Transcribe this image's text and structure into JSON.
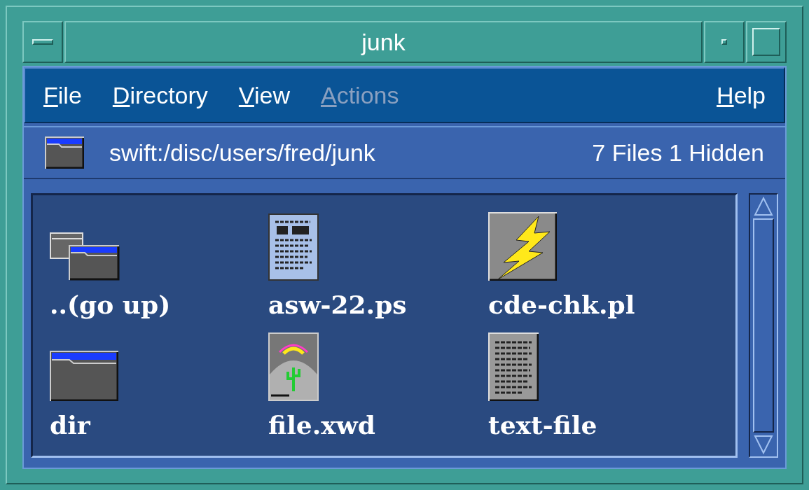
{
  "window": {
    "title": "junk"
  },
  "menu": [
    {
      "label": "File",
      "disabled": false
    },
    {
      "label": "Directory",
      "disabled": false
    },
    {
      "label": "View",
      "disabled": false
    },
    {
      "label": "Actions",
      "disabled": true
    },
    {
      "label": "Help",
      "disabled": false
    }
  ],
  "path_bar": {
    "path": "swift:/disc/users/fred/junk",
    "summary": "7 Files 1 Hidden"
  },
  "files": [
    {
      "name": "..(go up)",
      "kind": "parent"
    },
    {
      "name": "asw-22.ps",
      "kind": "postscript"
    },
    {
      "name": "cde-chk.pl",
      "kind": "script"
    },
    {
      "name": "dir",
      "kind": "folder"
    },
    {
      "name": "file.xwd",
      "kind": "image"
    },
    {
      "name": "text-file",
      "kind": "text"
    }
  ]
}
